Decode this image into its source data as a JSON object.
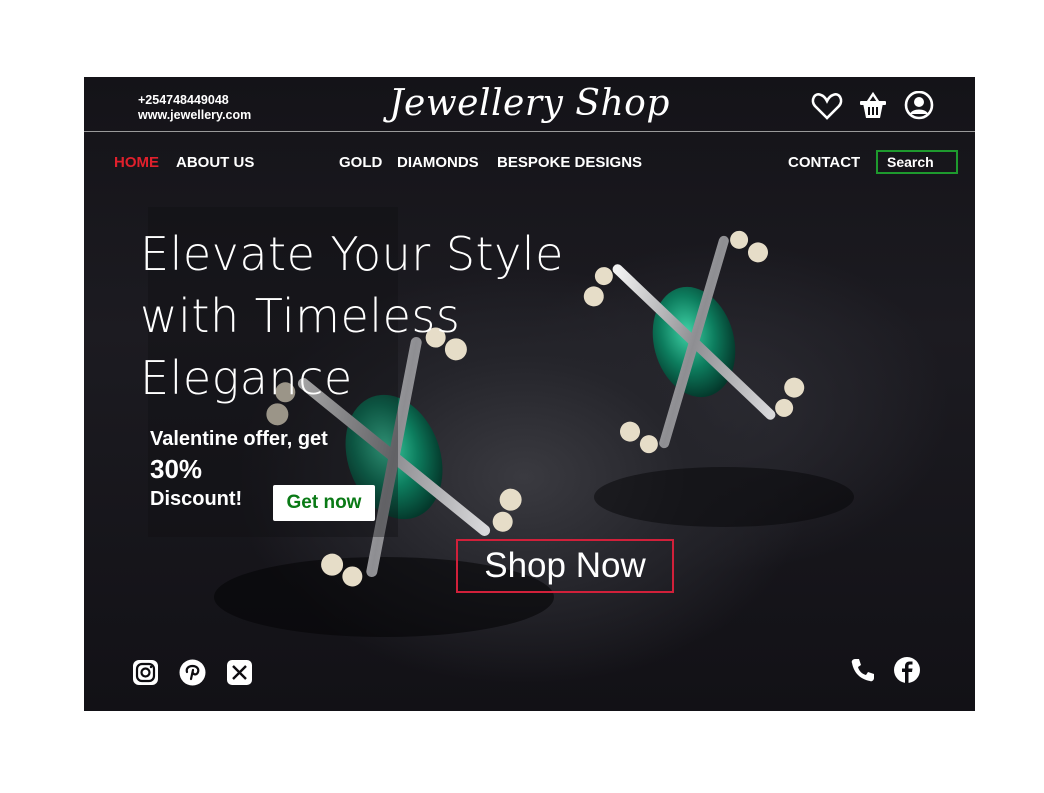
{
  "header": {
    "phone": "+254748449048",
    "website": "www.jewellery.com",
    "logo": "Jewellery Shop",
    "icons": [
      "heart-icon",
      "basket-icon",
      "user-icon"
    ]
  },
  "nav": {
    "home": "HOME",
    "about": "ABOUT US",
    "gold": "GOLD",
    "diamonds": "DIAMONDS",
    "bespoke": "BESPOKE DESIGNS",
    "contact": "CONTACT",
    "search": "Search"
  },
  "hero": {
    "headline": [
      "Elevate Your Style",
      "with Timeless",
      "Elegance"
    ],
    "offer_line1": "Valentine offer, get",
    "offer_line2": "30%",
    "offer_line3": "Discount!",
    "get_now": "Get now",
    "shop_now": "Shop Now"
  },
  "footer": {
    "social_left": [
      "instagram-icon",
      "pinterest-icon",
      "x-icon"
    ],
    "social_right": [
      "phone-icon",
      "facebook-icon"
    ]
  },
  "colors": {
    "background": "#0d0c10",
    "active_nav": "#e0202c",
    "search_border": "#1e9a2e",
    "get_now_text": "#0a7a16",
    "shop_now_border": "#d1203a"
  }
}
